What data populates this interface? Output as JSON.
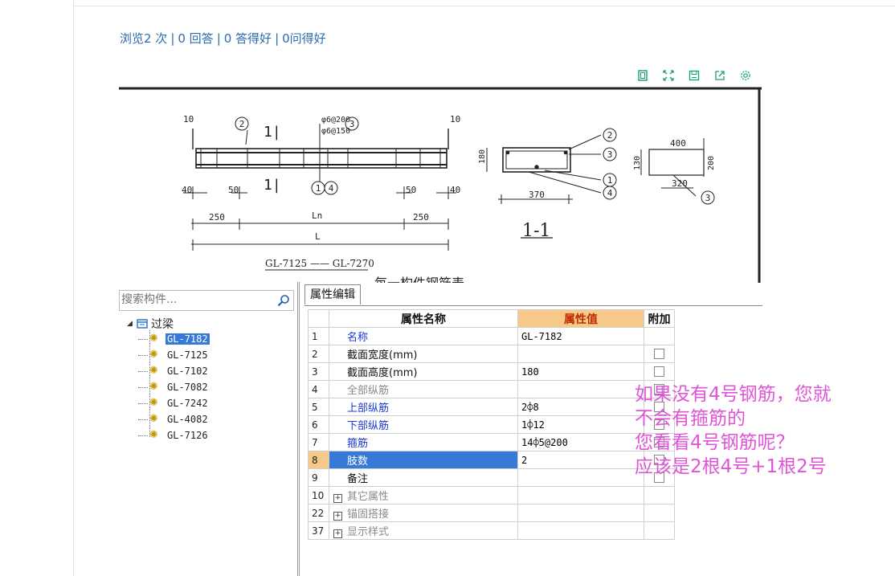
{
  "stats": {
    "views": "浏览2 次",
    "answers": "0 回答",
    "good_answers": "0 答得好",
    "good_questions": "0问得好",
    "sep": "|"
  },
  "drawing": {
    "labels": {
      "d10a": "10",
      "d10b": "10",
      "c2": "2",
      "c3": "3",
      "c1": "1",
      "c4": "4",
      "sec": "1|",
      "sec2": "1|",
      "s1": "φ6@200",
      "s2": "φ6@150",
      "d40a": "40",
      "d50a": "50",
      "d50b": "50",
      "d40b": "40",
      "d250a": "250",
      "d250b": "250",
      "ln": "Ln",
      "l": "L",
      "title": "GL-7125 —— GL-7270",
      "sect_title": "1-1",
      "d180": "180",
      "d370": "370",
      "d400": "400",
      "d130": "130",
      "d200": "200",
      "d320": "320",
      "cut": "每一构件钢筋表"
    }
  },
  "search": {
    "placeholder": "搜索构件..."
  },
  "tree": {
    "root": "过梁",
    "items": [
      "GL-7182",
      "GL-7125",
      "GL-7102",
      "GL-7082",
      "GL-7242",
      "GL-4082",
      "GL-7126"
    ]
  },
  "tab": {
    "label": "属性编辑"
  },
  "table": {
    "headers": {
      "name": "属性名称",
      "value": "属性值",
      "add": "附加"
    },
    "rows": [
      {
        "num": "1",
        "name": "名称",
        "value": "GL-7182",
        "color": "blue",
        "check": false,
        "plus": false
      },
      {
        "num": "2",
        "name": "截面宽度(mm)",
        "value": "",
        "color": "black",
        "check": true,
        "plus": false
      },
      {
        "num": "3",
        "name": "截面高度(mm)",
        "value": "180",
        "color": "black",
        "check": true,
        "plus": false
      },
      {
        "num": "4",
        "name": "全部纵筋",
        "value": "",
        "color": "gray",
        "check": true,
        "plus": false
      },
      {
        "num": "5",
        "name": "上部纵筋",
        "value": "2⌽8",
        "color": "blue",
        "check": true,
        "plus": false
      },
      {
        "num": "6",
        "name": "下部纵筋",
        "value": "1⌽12",
        "color": "blue",
        "check": true,
        "plus": false
      },
      {
        "num": "7",
        "name": "箍筋",
        "value": "14⌽5@200",
        "color": "blue",
        "check": true,
        "plus": false
      },
      {
        "num": "8",
        "name": "肢数",
        "value": "2",
        "color": "blue",
        "check": true,
        "plus": false,
        "selected": true
      },
      {
        "num": "9",
        "name": "备注",
        "value": "",
        "color": "black",
        "check": true,
        "plus": false
      },
      {
        "num": "10",
        "name": "其它属性",
        "value": "",
        "color": "gray",
        "check": false,
        "plus": true
      },
      {
        "num": "22",
        "name": "锚固搭接",
        "value": "",
        "color": "gray",
        "check": false,
        "plus": true
      },
      {
        "num": "37",
        "name": "显示样式",
        "value": "",
        "color": "gray",
        "check": false,
        "plus": true
      }
    ]
  },
  "note": {
    "line1": "如果没有4号钢筋，您就",
    "line2": "不会有箍筋的",
    "line3": "您看看4号钢筋呢？",
    "line4": "应该是2根4号+1根2号"
  },
  "colors": {
    "accent": "#2b6cb0",
    "note": "#e055d8",
    "header_value_bg": "#f7c989",
    "selection": "#3779d6"
  }
}
